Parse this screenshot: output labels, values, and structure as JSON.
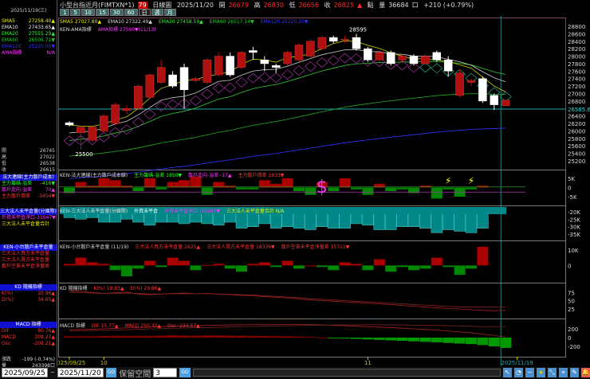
{
  "left": {
    "date": "2025/11/19(三)",
    "ma": [
      {
        "k": "SMA5",
        "v": "27258.40",
        "a": "▲",
        "c": "#ee0"
      },
      {
        "k": "EMA10",
        "v": "27433.65",
        "a": "▲",
        "c": "#eee"
      },
      {
        "k": "EMA20",
        "v": "27555.29",
        "a": "▲",
        "c": "#2f2"
      },
      {
        "k": "EMA60",
        "v": "26506.71",
        "a": "▼",
        "c": "#2c2"
      },
      {
        "k": "EMA120",
        "v": "25220.00",
        "a": "▼",
        "c": "#33f"
      },
      {
        "k": "AMA指標",
        "v": "N/A",
        "a": "",
        "c": "#f3f"
      }
    ],
    "ohlc": [
      {
        "k": "開",
        "v": "26745"
      },
      {
        "k": "高",
        "v": "27022"
      },
      {
        "k": "低",
        "v": "26538"
      },
      {
        "k": "收",
        "v": "26615"
      }
    ],
    "sec1": {
      "title": "法大連線(主力散戶成本)",
      "rows": [
        {
          "k": "主力籌碼-溢差",
          "v": "-416▼",
          "c": "#2f2"
        },
        {
          "k": "散戶走向-溢差",
          "v": "70▲",
          "c": "#f3f"
        },
        {
          "k": "主力散戶價差",
          "v": "-3454▼",
          "c": "#f33"
        }
      ]
    },
    "sec2": {
      "title": "三大法人未平倉量(分國際)",
      "rows": [
        {
          "k": "外資未平倉淨口",
          "v": "-31047▼",
          "c": "#f3f"
        },
        {
          "k": "三大法人未平倉量合計",
          "v": "",
          "c": "#ee0"
        }
      ]
    },
    "sec3": {
      "title": "KEN-小台散戶未平倉量",
      "rows": [
        {
          "k": "三大法人買方未平倉量",
          "v": "",
          "c": "#f33"
        },
        {
          "k": "三大法人賣方未平倉量",
          "v": "",
          "c": "#f33"
        },
        {
          "k": "散戶空單未平倉淨量差",
          "v": "",
          "c": "#f33"
        }
      ]
    },
    "kd": {
      "title": "KD 隨機指標",
      "rows": [
        {
          "k": "K(%)",
          "v": "20.96▲",
          "c": "#f33"
        },
        {
          "k": "D(%)",
          "v": "34.65▲",
          "c": "#f33"
        }
      ]
    },
    "macd": {
      "title": "MACD 指標",
      "rows": [
        {
          "k": "DIF",
          "v": "80.76▲",
          "c": "#f33"
        },
        {
          "k": "MACD",
          "v": "308.27▲",
          "c": "#f33"
        },
        {
          "k": "Osc",
          "v": "-208.21▲",
          "c": "#f33"
        }
      ]
    },
    "chg": {
      "k": "漲跌",
      "v": "-199 (-0.74%)"
    },
    "vol": {
      "k": "量",
      "v": "243398口"
    }
  },
  "header": {
    "name": "小型台指近月(FIMTXN*1)",
    "badge": "79",
    "period": "日線圖",
    "date": "2025/11/20",
    "open_k": "開",
    "open": "26679",
    "high_k": "高",
    "high": "26830",
    "low_k": "低",
    "low": "26656",
    "close_k": "收",
    "close": "26825",
    "close_arrow": "▲",
    "pts_k": "點",
    "vol_k": "量",
    "vol": "36684",
    "vol_unit": "口",
    "change": "+210 (+0.79%)",
    "buttons": [
      "1",
      "5",
      "10",
      "15",
      "30",
      "60",
      "日",
      "週",
      "月"
    ]
  },
  "legends": {
    "ma": [
      {
        "t": "SMA5 27027.80▲",
        "c": "#ee0"
      },
      {
        "t": "EMA10 27322.49▲",
        "c": "#ddd"
      },
      {
        "t": "EMA20 27458.59▲",
        "c": "#2f2"
      },
      {
        "t": "EMA60 26517.14▼",
        "c": "#2c2"
      },
      {
        "t": "EMA120 25220.20▼",
        "c": "#33f"
      }
    ],
    "ama": [
      {
        "t": "KEN-AMA指標",
        "c": "#ddd"
      },
      {
        "t": "AMA指標 27590▼(11/13)",
        "c": "#f3f"
      }
    ],
    "p1": [
      {
        "t": "KEN-法大連線(主力散戶成本線)",
        "c": "#ddd"
      },
      {
        "t": "主力籌碼-溢差 1850▼",
        "c": "#2f2"
      },
      {
        "t": "散戶走向-溢差 -17▲",
        "c": "#f3f"
      },
      {
        "t": "主力散戶價差 1833▼",
        "c": "#f33"
      }
    ],
    "p2": [
      {
        "t": "KEN-三大法人未平倉量(分國際)",
        "c": "#ddd"
      },
      {
        "t": "外資未平倉",
        "c": "#fff"
      },
      {
        "t": "外資未平倉淨口 -31047▼",
        "c": "#f3f"
      },
      {
        "t": "三大法人未平倉量合計 N/A",
        "c": "#ee0"
      }
    ],
    "p3": [
      {
        "t": "KEN-小台散戶未平倉量 (11/19)",
        "c": "#ddd"
      },
      {
        "t": "三大法人買方未平倉量 2625▲",
        "c": "#f33"
      },
      {
        "t": "三大法人賣方未平倉量 18336▼",
        "c": "#f33"
      },
      {
        "t": "散戶空單未平倉淨量差 15711▼",
        "c": "#f33"
      }
    ],
    "kd": [
      {
        "t": "KD 隨機指標",
        "c": "#ddd"
      },
      {
        "t": "K(%) 19.83▲",
        "c": "#f33"
      },
      {
        "t": "D(%) 29.86▲",
        "c": "#f33"
      }
    ],
    "macd": [
      {
        "t": "MACD 指標",
        "c": "#ddd"
      },
      {
        "t": "DIF 15.77▲",
        "c": "#f33"
      },
      {
        "t": "MACD 250.33▲",
        "c": "#f33"
      },
      {
        "t": "Osc -234.57▲",
        "c": "#f33"
      }
    ]
  },
  "axis": {
    "price_ticks": [
      28800,
      28600,
      28400,
      28200,
      28000,
      27800,
      27600,
      27400,
      27200,
      27000,
      26800,
      26600,
      26400,
      26200,
      26000,
      25800,
      25600,
      25400,
      25200
    ],
    "cursor_price": "26585.6",
    "p1_ticks": [
      "5K",
      "0",
      "-5K"
    ],
    "p2_ticks": [
      "-20K",
      "-25K",
      "-30K",
      "-35K"
    ],
    "p3_ticks": [
      "10K",
      "0"
    ],
    "kd_ticks": [
      "75",
      "50",
      "25"
    ],
    "macd_ticks": [
      "200",
      "0",
      "-200"
    ],
    "dates": [
      {
        "t": "2025/09/25",
        "i": 0
      },
      {
        "t": "10",
        "i": 3
      },
      {
        "t": "11",
        "i": 26
      },
      {
        "t": "2025/11/19",
        "i": 39
      }
    ],
    "high_label": "28595",
    "low_label": "25500"
  },
  "chart_data": {
    "type": "candlestick",
    "ohlc": [
      [
        26220,
        26260,
        26120,
        26160
      ],
      [
        25950,
        26150,
        25500,
        26100
      ],
      [
        25750,
        26150,
        25700,
        26100
      ],
      [
        26000,
        26450,
        25950,
        26400
      ],
      [
        26200,
        26750,
        26150,
        26700
      ],
      [
        26550,
        26700,
        26450,
        26600
      ],
      [
        26600,
        27250,
        26550,
        27200
      ],
      [
        26900,
        27550,
        26850,
        27500
      ],
      [
        27300,
        27900,
        27250,
        27700
      ],
      [
        27500,
        27600,
        27150,
        27200
      ],
      [
        27700,
        27800,
        26600,
        27100
      ],
      [
        27350,
        27450,
        27300,
        27400
      ],
      [
        27300,
        27950,
        27250,
        27900
      ],
      [
        27500,
        28100,
        27450,
        28000
      ],
      [
        28000,
        28100,
        27450,
        27500
      ],
      [
        27700,
        28150,
        27650,
        28100
      ],
      [
        28150,
        28250,
        27900,
        28100
      ],
      [
        27900,
        28000,
        27600,
        27800
      ],
      [
        27750,
        27800,
        27550,
        27700
      ],
      [
        27800,
        28150,
        27750,
        28100
      ],
      [
        27900,
        28350,
        27850,
        28300
      ],
      [
        28000,
        28450,
        27950,
        28400
      ],
      [
        28200,
        28550,
        28150,
        28500
      ],
      [
        28500,
        28550,
        28350,
        28400
      ],
      [
        28450,
        28550,
        28350,
        28450
      ],
      [
        28500,
        28595,
        28150,
        28200
      ],
      [
        28200,
        28250,
        27850,
        27900
      ],
      [
        27900,
        28150,
        27850,
        28100
      ],
      [
        28100,
        28150,
        27750,
        27800
      ],
      [
        27900,
        28050,
        27850,
        28000
      ],
      [
        28000,
        28050,
        27750,
        27800
      ],
      [
        27800,
        28050,
        27750,
        28000
      ],
      [
        28100,
        28150,
        27850,
        27900
      ],
      [
        27900,
        28000,
        27450,
        27600
      ],
      [
        26950,
        27650,
        26900,
        27550
      ],
      [
        27300,
        27400,
        27200,
        27350
      ],
      [
        27400,
        27450,
        26750,
        26800
      ],
      [
        26950,
        27000,
        26560,
        26700
      ],
      [
        26679,
        26830,
        26656,
        26825
      ]
    ],
    "foreign_net": [
      -3,
      3,
      1,
      5,
      4,
      1,
      -2,
      5,
      -1,
      3,
      4,
      6,
      -4,
      3,
      1,
      -1,
      -1,
      4,
      2,
      5,
      -2,
      -4,
      3,
      -2,
      5,
      -1,
      -4,
      2,
      -2,
      -1,
      -3,
      1,
      -6,
      -1,
      -5,
      -1,
      1
    ],
    "oi_foreign": [
      -24,
      -25,
      -24,
      -27,
      -27,
      -25,
      -27,
      -29,
      -27,
      -27,
      -28,
      -27,
      -28,
      -29,
      -27,
      -31,
      -30,
      -28,
      -31,
      -30,
      -31,
      -32,
      -30,
      -31,
      -31,
      -28,
      -29,
      -32,
      -32,
      -30,
      -30,
      -31,
      -34,
      -32,
      -33,
      -34,
      -31
    ],
    "retail_oi": [
      1,
      5,
      2,
      1,
      -3,
      -7,
      -2,
      3,
      -1,
      5,
      3,
      -3,
      0.3,
      1,
      -2,
      -4,
      1,
      2,
      -1,
      3,
      -2,
      0,
      -1,
      -3,
      2,
      1,
      -3,
      4,
      -4,
      -1,
      -3,
      -2,
      5,
      -1,
      -6,
      -2,
      12
    ],
    "k": [
      80,
      78,
      75,
      72,
      74,
      76,
      70,
      68,
      70,
      72,
      73,
      71,
      72,
      70,
      68,
      66,
      65,
      62,
      60,
      58,
      55,
      52,
      50,
      48,
      46,
      44,
      42,
      40,
      38,
      35,
      33,
      30,
      28,
      26,
      24,
      22,
      20,
      19,
      19.83
    ],
    "d": [
      75,
      74,
      73,
      72,
      72,
      73,
      72,
      70,
      70,
      71,
      71,
      71,
      71,
      70,
      69,
      68,
      67,
      65,
      63,
      61,
      59,
      56,
      54,
      52,
      50,
      48,
      46,
      44,
      42,
      40,
      38,
      36,
      34,
      32,
      31,
      30,
      30,
      30,
      29.86
    ],
    "dif": [
      180,
      185,
      190,
      200,
      210,
      220,
      230,
      240,
      250,
      260,
      265,
      270,
      280,
      285,
      290,
      292,
      295,
      296,
      298,
      300,
      298,
      295,
      290,
      280,
      270,
      260,
      250,
      240,
      228,
      215,
      200,
      185,
      170,
      150,
      130,
      110,
      80,
      50,
      15.77
    ],
    "macd": [
      150,
      155,
      160,
      165,
      170,
      180,
      190,
      200,
      205,
      210,
      220,
      225,
      230,
      235,
      245,
      250,
      255,
      260,
      265,
      270,
      275,
      280,
      285,
      288,
      290,
      290,
      292,
      292,
      290,
      288,
      285,
      282,
      278,
      272,
      266,
      258,
      250,
      251,
      250.33
    ],
    "osc": [
      30,
      30,
      30,
      35,
      40,
      40,
      40,
      40,
      45,
      50,
      45,
      45,
      50,
      50,
      45,
      42,
      40,
      36,
      33,
      30,
      23,
      15,
      5,
      -8,
      -20,
      -30,
      -42,
      -52,
      -62,
      -73,
      -85,
      -97,
      -108,
      -122,
      -136,
      -148,
      -170,
      -201,
      -234.57
    ]
  }
}
